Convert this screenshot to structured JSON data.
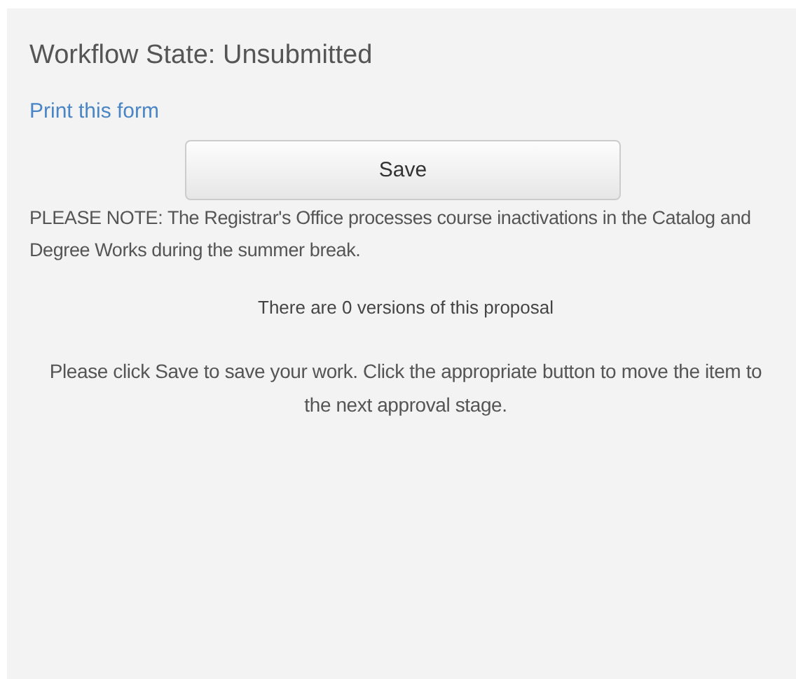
{
  "workflow_state": "Workflow State: Unsubmitted",
  "print_link": "Print this form",
  "save_button": "Save",
  "note": "PLEASE NOTE: The Registrar's Office processes course inactivations in the Catalog and Degree Works during the summer break.",
  "versions": "There are 0 versions of this proposal",
  "instructions": "Please click Save to save your work. Click the appropriate button to move the item to the next approval stage."
}
